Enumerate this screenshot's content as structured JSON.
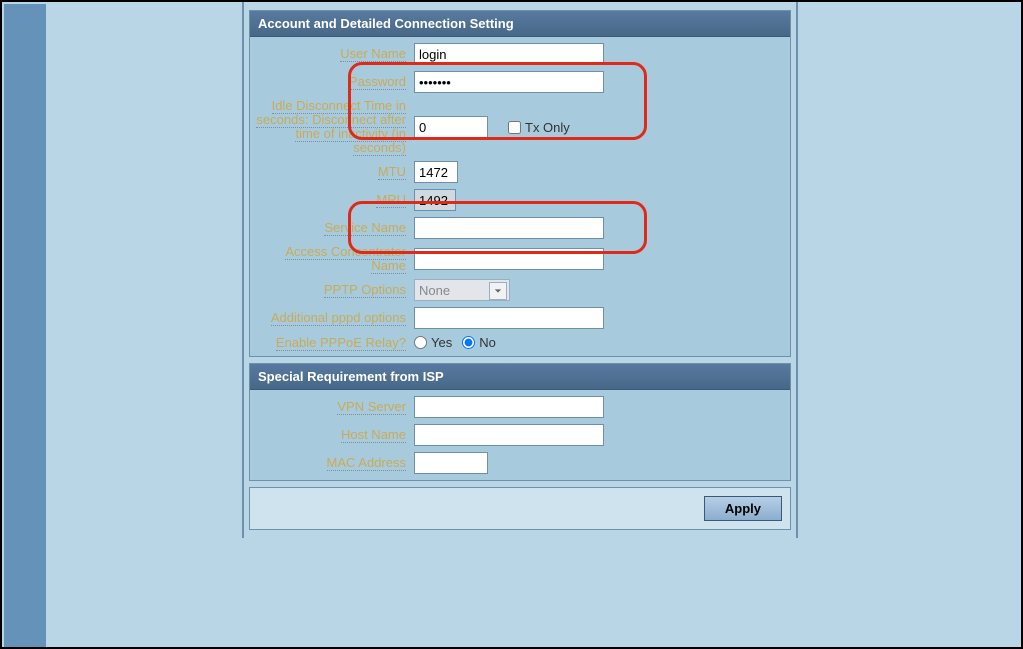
{
  "sections": {
    "account": {
      "header": "Account and Detailed Connection Setting",
      "labels": {
        "user_name": "User Name",
        "password": "Password",
        "idle_1": "Idle Disconnect Time in",
        "idle_2": "seconds: Disconnect after",
        "idle_3": "time of inactivity (in",
        "idle_4": "seconds)",
        "mtu": "MTU",
        "mru": "MRU",
        "service_name": "Service Name",
        "ac_name": "Access Concentrator Name",
        "pptp_options": "PPTP Options",
        "pppd_options": "Additional pppd options",
        "enable_relay": "Enable PPPoE Relay?",
        "tx_only": "Tx Only"
      },
      "values": {
        "user_name": "login",
        "password": "•••••••",
        "idle": "0",
        "mtu": "1472",
        "mru": "1492",
        "service_name": "",
        "ac_name": "",
        "pptp_options": "None",
        "pppd_options": "",
        "enable_relay": "No",
        "yes": "Yes",
        "no": "No"
      }
    },
    "isp": {
      "header": "Special Requirement from ISP",
      "labels": {
        "vpn_server": "VPN Server",
        "host_name": "Host Name",
        "mac_address": "MAC Address"
      },
      "values": {
        "vpn_server": "",
        "host_name": "",
        "mac_address": ""
      }
    }
  },
  "apply_button": "Apply"
}
